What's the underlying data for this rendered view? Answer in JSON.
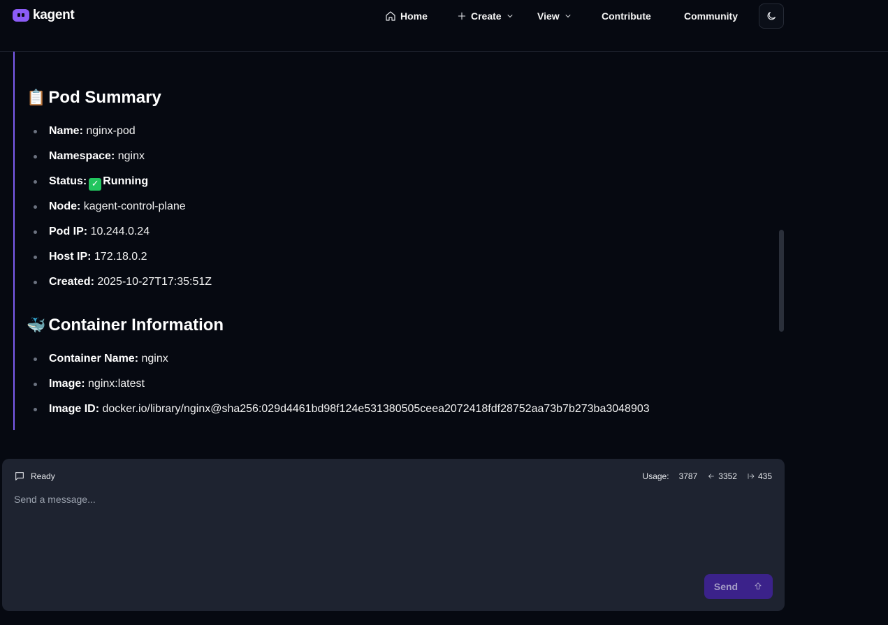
{
  "brand": {
    "name": "kagent"
  },
  "nav": {
    "home": "Home",
    "create": "Create",
    "view": "View",
    "contribute": "Contribute",
    "community": "Community"
  },
  "message": {
    "pod_summary": {
      "emoji": "📋",
      "title": "Pod Summary",
      "items": [
        {
          "key": "Name",
          "value": "nginx-pod"
        },
        {
          "key": "Namespace",
          "value": "nginx"
        },
        {
          "key": "Status",
          "value": "Running"
        },
        {
          "key": "Node",
          "value": "kagent-control-plane"
        },
        {
          "key": "Pod IP",
          "value": "10.244.0.24"
        },
        {
          "key": "Host IP",
          "value": "172.18.0.2"
        },
        {
          "key": "Created",
          "value": "2025-10-27T17:35:51Z"
        }
      ]
    },
    "container_info": {
      "emoji": "🐳",
      "title": "Container Information",
      "items": [
        {
          "key": "Container Name",
          "value": "nginx"
        },
        {
          "key": "Image",
          "value": "nginx:latest"
        },
        {
          "key": "Image ID",
          "value": "docker.io/library/nginx@sha256:029d4461bd98f124e531380505ceea2072418fdf28752aa73b7b273ba3048903"
        }
      ]
    }
  },
  "composer": {
    "status": "Ready",
    "usage_label": "Usage:",
    "usage_total": "3787",
    "usage_in": "3352",
    "usage_out": "435",
    "placeholder": "Send a message...",
    "send_label": "Send"
  },
  "colors": {
    "background": "#060911",
    "accent": "#8b5cf6",
    "composer_bg": "#1e2330",
    "send_button": "#3b228a",
    "status_ok": "#22c55e"
  }
}
